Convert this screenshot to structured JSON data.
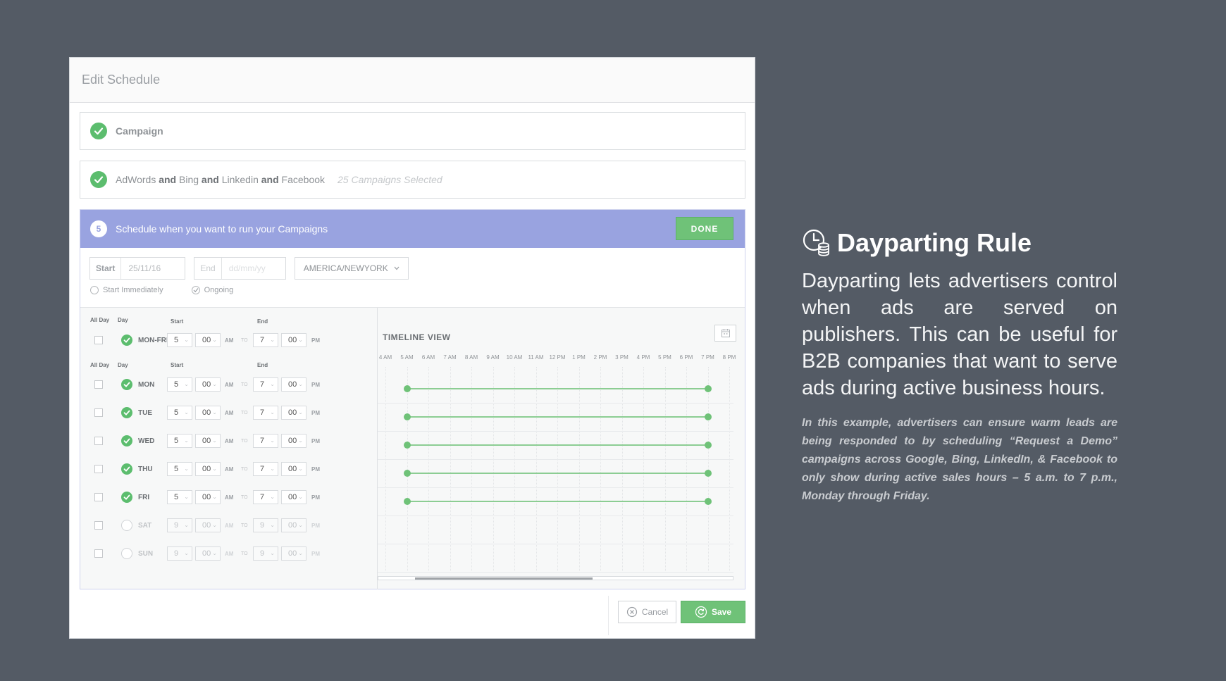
{
  "modal": {
    "title": "Edit Schedule",
    "step1_label": "Campaign",
    "step2": {
      "n1": "AdWords",
      "and1": "and",
      "n2": "Bing",
      "and2": "and",
      "n3": "Linkedin",
      "and3": "and",
      "n4": "Facebook",
      "note": "25 Campaigns Selected"
    },
    "step3": {
      "number": "5",
      "label": "Schedule when you want to run your Campaigns",
      "done_label": "DONE",
      "start_label": "Start",
      "start_value": "25/11/16",
      "end_label": "End",
      "end_placeholder": "dd/mm/yy",
      "timezone": "AMERICA/NEWYORK",
      "radio_start": "Start Immediately",
      "radio_ongoing": "Ongoing"
    },
    "headers": {
      "all_day": "All Day",
      "day": "Day",
      "start": "Start",
      "end": "End"
    },
    "group_row": {
      "day": "MON-FRI",
      "start_h": "5",
      "start_m": "00",
      "start_mer": "AM",
      "to": "TO",
      "end_h": "7",
      "end_m": "00",
      "end_mer": "PM"
    },
    "days": [
      {
        "day": "MON",
        "active": true,
        "start_h": "5",
        "start_m": "00",
        "start_mer": "AM",
        "to": "TO",
        "end_h": "7",
        "end_m": "00",
        "end_mer": "PM"
      },
      {
        "day": "TUE",
        "active": true,
        "start_h": "5",
        "start_m": "00",
        "start_mer": "AM",
        "to": "TO",
        "end_h": "7",
        "end_m": "00",
        "end_mer": "PM"
      },
      {
        "day": "WED",
        "active": true,
        "start_h": "5",
        "start_m": "00",
        "start_mer": "AM",
        "to": "TO",
        "end_h": "7",
        "end_m": "00",
        "end_mer": "PM"
      },
      {
        "day": "THU",
        "active": true,
        "start_h": "5",
        "start_m": "00",
        "start_mer": "AM",
        "to": "TO",
        "end_h": "7",
        "end_m": "00",
        "end_mer": "PM"
      },
      {
        "day": "FRI",
        "active": true,
        "start_h": "5",
        "start_m": "00",
        "start_mer": "AM",
        "to": "TO",
        "end_h": "7",
        "end_m": "00",
        "end_mer": "PM"
      },
      {
        "day": "SAT",
        "active": false,
        "start_h": "9",
        "start_m": "00",
        "start_mer": "AM",
        "to": "TO",
        "end_h": "9",
        "end_m": "00",
        "end_mer": "PM"
      },
      {
        "day": "SUN",
        "active": false,
        "start_h": "9",
        "start_m": "00",
        "start_mer": "AM",
        "to": "TO",
        "end_h": "9",
        "end_m": "00",
        "end_mer": "PM"
      }
    ],
    "timeline": {
      "title": "TIMELINE VIEW",
      "ticks": [
        "4 AM",
        "5 AM",
        "6 AM",
        "7 AM",
        "8 AM",
        "9 AM",
        "10 AM",
        "11 AM",
        "12 PM",
        "1 PM",
        "2 PM",
        "3 PM",
        "4 PM",
        "5 PM",
        "6 PM",
        "7 PM",
        "8 PM"
      ],
      "bar_start_tick": 1,
      "bar_end_tick": 15
    },
    "cancel_label": "Cancel",
    "save_label": "Save"
  },
  "side": {
    "title": "Dayparting Rule",
    "description": "Dayparting lets advertisers control when ads are served on publishers. This can be useful for B2B companies that want to serve ads during active business hours.",
    "example": "In this example, advertisers can ensure warm leads are being responded to by scheduling “Request a Demo” campaigns across Google, Bing, LinkedIn, & Facebook to only show during active sales hours – 5 a.m. to 7 p.m., Monday through Friday."
  },
  "colors": {
    "accent_green": "#6fc278",
    "step_purple": "#99a3e0",
    "background": "#545b65"
  }
}
